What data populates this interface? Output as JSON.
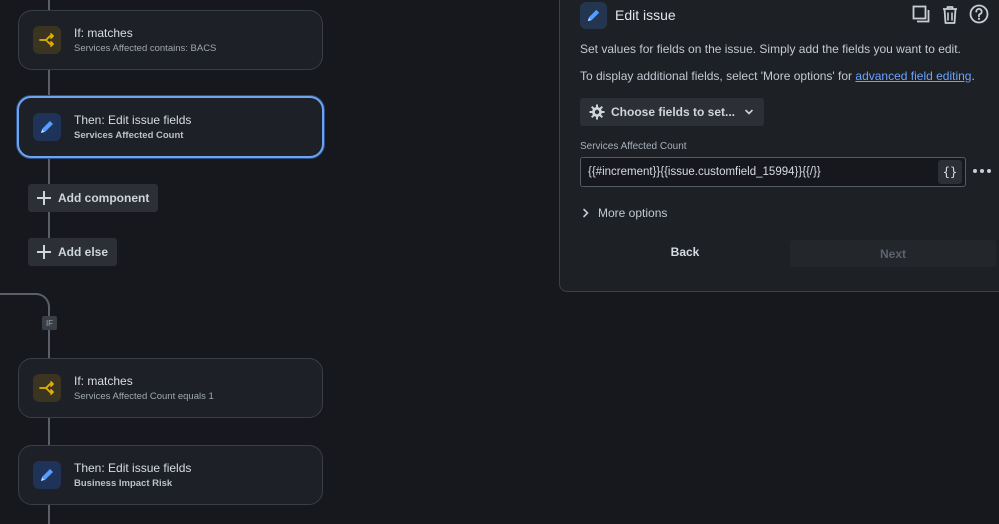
{
  "flow": {
    "cards": [
      {
        "title": "If: matches",
        "subtitle": "Services Affected contains: BACS",
        "kind": "condition"
      },
      {
        "title": "Then: Edit issue fields",
        "subtitle": "Services Affected Count",
        "kind": "action",
        "selected": true
      },
      {
        "title": "If: matches",
        "subtitle": "Services Affected Count equals 1",
        "kind": "condition"
      },
      {
        "title": "Then: Edit issue fields",
        "subtitle": "Business Impact Risk",
        "kind": "action"
      }
    ],
    "add_component_label": "Add component",
    "add_else_label": "Add else",
    "if_badge": "IF"
  },
  "panel": {
    "title": "Edit issue",
    "description": "Set values for fields on the issue. Simply add the fields you want to edit.",
    "additional_prefix": "To display additional fields, select 'More options' for ",
    "additional_link": "advanced field editing",
    "additional_suffix": ".",
    "choose_fields_label": "Choose fields to set...",
    "field_label": "Services Affected Count",
    "field_value": "{{#increment}}{{issue.customfield_15994}}{{/}}",
    "braces_label": "{}",
    "more_options_label": "More options",
    "back_label": "Back",
    "next_label": "Next"
  },
  "colors": {
    "background": "#16181d",
    "card_bg": "#1d2026",
    "accent_blue": "#6ea3f0",
    "condition_icon": "#e2b203",
    "action_icon": "#579dff",
    "link": "#6aa2ff"
  },
  "icons": {
    "condition": "branch-icon",
    "action": "pencil-icon",
    "copy": "duplicate-icon",
    "delete": "trash-icon",
    "help": "help-icon",
    "choose": "gear-icon"
  }
}
